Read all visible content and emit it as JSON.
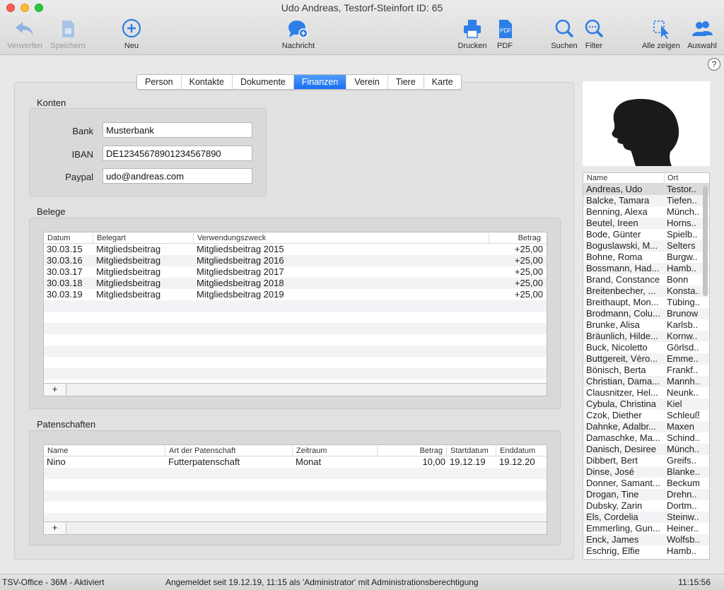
{
  "window": {
    "title": "Udo Andreas, Testorf-Steinfort ID: 65"
  },
  "toolbar": {
    "discard": "Verwerfen",
    "save": "Speichern",
    "new": "Neu",
    "message": "Nachricht",
    "print": "Drucken",
    "pdf": "PDF",
    "search": "Suchen",
    "filter": "Filter",
    "show_all": "Alle zeigen",
    "selection": "Auswahl",
    "pdf_icon_text": "PDF"
  },
  "help": "?",
  "tabs": [
    "Person",
    "Kontakte",
    "Dokumente",
    "Finanzen",
    "Verein",
    "Tiere",
    "Karte"
  ],
  "active_tab": "Finanzen",
  "konten": {
    "title": "Konten",
    "bank_label": "Bank",
    "bank_value": "Musterbank",
    "iban_label": "IBAN",
    "iban_value": "DE12345678901234567890",
    "paypal_label": "Paypal",
    "paypal_value": "udo@andreas.com"
  },
  "belege": {
    "title": "Belege",
    "columns": [
      "Datum",
      "Belegart",
      "Verwendungszweck",
      "Betrag"
    ],
    "rows": [
      [
        "30.03.15",
        "Mitgliedsbeitrag",
        "Mitgliedsbeitrag 2015",
        "+25,00"
      ],
      [
        "30.03.16",
        "Mitgliedsbeitrag",
        "Mitgliedsbeitrag 2016",
        "+25,00"
      ],
      [
        "30.03.17",
        "Mitgliedsbeitrag",
        "Mitgliedsbeitrag 2017",
        "+25,00"
      ],
      [
        "30.03.18",
        "Mitgliedsbeitrag",
        "Mitgliedsbeitrag 2018",
        "+25,00"
      ],
      [
        "30.03.19",
        "Mitgliedsbeitrag",
        "Mitgliedsbeitrag 2019",
        "+25,00"
      ]
    ],
    "add_label": "+"
  },
  "patenschaften": {
    "title": "Patenschaften",
    "columns": [
      "Name",
      "Art der Patenschaft",
      "Zeitraum",
      "Betrag",
      "Startdatum",
      "Enddatum"
    ],
    "rows": [
      [
        "Nino",
        "Futterpatenschaft",
        "Monat",
        "10,00",
        "19.12.19",
        "19.12.20"
      ]
    ],
    "add_label": "+"
  },
  "people_list": {
    "columns": [
      "Name",
      "Ort"
    ],
    "selected_index": 0,
    "rows": [
      [
        "Andreas, Udo",
        "Testor.."
      ],
      [
        "Balcke, Tamara",
        "Tiefen.."
      ],
      [
        "Benning, Alexa",
        "Münch.."
      ],
      [
        "Beutel, Ireen",
        "Horns.."
      ],
      [
        "Bode, Günter",
        "Spielb.."
      ],
      [
        "Boguslawski, M...",
        "Selters"
      ],
      [
        "Bohne, Roma",
        "Burgw.."
      ],
      [
        "Bossmann, Had...",
        "Hamb.."
      ],
      [
        "Brand, Constance",
        "Bonn"
      ],
      [
        "Breitenbecher, ...",
        "Konsta.."
      ],
      [
        "Breithaupt, Mon...",
        "Tübing.."
      ],
      [
        "Brodmann, Colu...",
        "Brunow"
      ],
      [
        "Brunke, Alisa",
        "Karlsb.."
      ],
      [
        "Bräunlich, Hilde...",
        "Kornw.."
      ],
      [
        "Buck, Nicoletto",
        "Görlsd.."
      ],
      [
        "Buttgereit, Vèro...",
        "Emme.."
      ],
      [
        "Bönisch, Berta",
        "Frankf.."
      ],
      [
        "Christian, Dama...",
        "Mannh.."
      ],
      [
        "Clausnitzer, Hel...",
        "Neunk.."
      ],
      [
        "Cybula, Christina",
        "Kiel"
      ],
      [
        "Czok, Diether",
        "Schleuß"
      ],
      [
        "Dahnke, Adalbr...",
        "Maxen"
      ],
      [
        "Damaschke, Ma...",
        "Schind.."
      ],
      [
        "Danisch, Desiree",
        "Münch.."
      ],
      [
        "Dibbert, Bert",
        "Greifs.."
      ],
      [
        "Dinse, José",
        "Blanke.."
      ],
      [
        "Donner, Samant...",
        "Beckum"
      ],
      [
        "Drogan, Tine",
        "Drehn.."
      ],
      [
        "Dubsky, Zarin",
        "Dortm.."
      ],
      [
        "Els, Cordelia",
        "Steinw.."
      ],
      [
        "Emmerling, Gun...",
        "Heiner.."
      ],
      [
        "Enck, James",
        "Wolfsb.."
      ],
      [
        "Eschrig, Elfie",
        "Hamb.."
      ]
    ]
  },
  "status": {
    "left": "TSV-Office - 36M - Aktiviert",
    "center": "Angemeldet seit 19.12.19, 11:15 als 'Administrator' mit Administrationsberechtigung",
    "right": "11:15:56"
  },
  "colors": {
    "accent": "#1a6ff0",
    "icon_blue": "#2d7ee6"
  }
}
